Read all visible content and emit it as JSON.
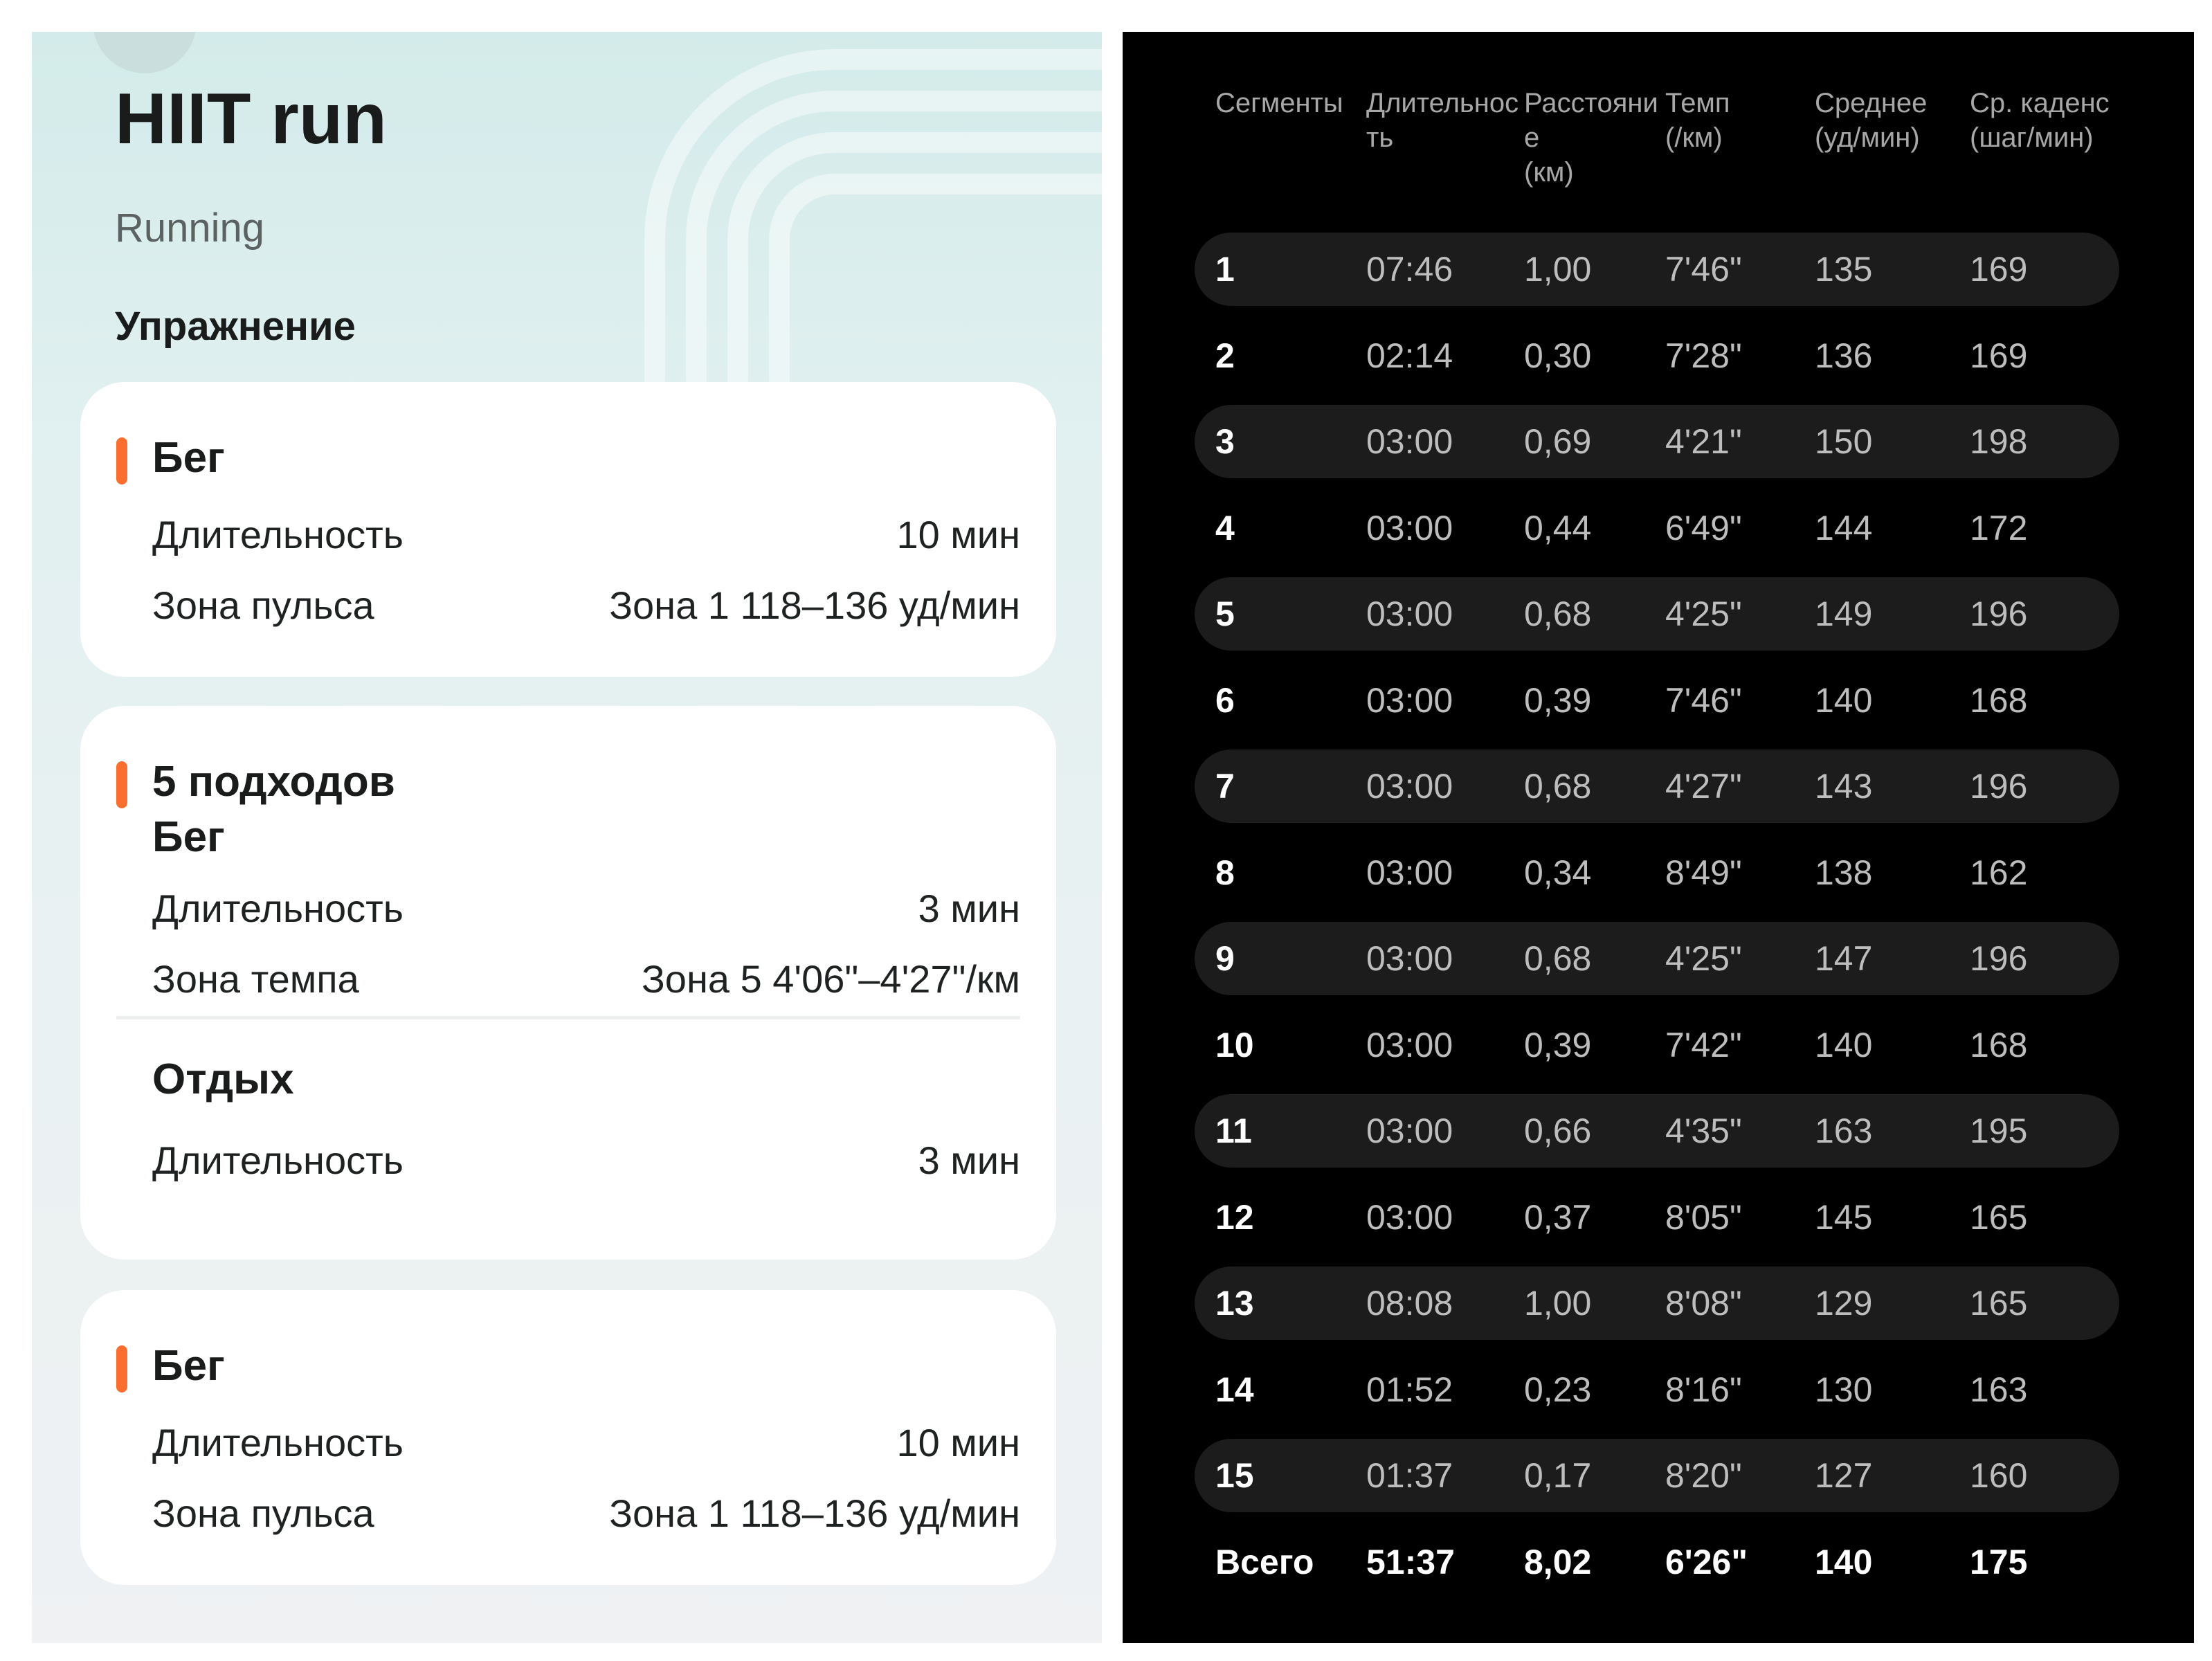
{
  "workout": {
    "title": "HIIT run",
    "subtitle": "Running",
    "section_title": "Упражнение",
    "card1": {
      "step": {
        "title": "Бег"
      },
      "duration": {
        "label": "Длительность",
        "value": "10 мин"
      },
      "zone": {
        "label": "Зона пульса",
        "value": "Зона 1 118–136 уд/мин"
      }
    },
    "card2": {
      "sets_title": "5 подходов",
      "run": {
        "title": "Бег",
        "duration": {
          "label": "Длительность",
          "value": "3 мин"
        },
        "zone": {
          "label": "Зона темпа",
          "value": "Зона 5 4'06\"–4'27\"/км"
        }
      },
      "rest": {
        "title": "Отдых",
        "duration": {
          "label": "Длительность",
          "value": "3 мин"
        }
      }
    },
    "card3": {
      "step": {
        "title": "Бег"
      },
      "duration": {
        "label": "Длительность",
        "value": "10 мин"
      },
      "zone": {
        "label": "Зона пульса",
        "value": "Зона 1 118–136 уд/мин"
      }
    },
    "colors": {
      "accent": "#fb6f2e"
    }
  },
  "segments_table": {
    "headers": [
      "Сегменты",
      "Длительнос\nть",
      "Расстояни\nе\n(км)",
      "Темп\n(/км)",
      "Среднее\n(уд/мин)",
      "Ср. каденс\n(шаг/мин)"
    ],
    "rows": [
      [
        "1",
        "07:46",
        "1,00",
        "7'46\"",
        "135",
        "169"
      ],
      [
        "2",
        "02:14",
        "0,30",
        "7'28\"",
        "136",
        "169"
      ],
      [
        "3",
        "03:00",
        "0,69",
        "4'21\"",
        "150",
        "198"
      ],
      [
        "4",
        "03:00",
        "0,44",
        "6'49\"",
        "144",
        "172"
      ],
      [
        "5",
        "03:00",
        "0,68",
        "4'25\"",
        "149",
        "196"
      ],
      [
        "6",
        "03:00",
        "0,39",
        "7'46\"",
        "140",
        "168"
      ],
      [
        "7",
        "03:00",
        "0,68",
        "4'27\"",
        "143",
        "196"
      ],
      [
        "8",
        "03:00",
        "0,34",
        "8'49\"",
        "138",
        "162"
      ],
      [
        "9",
        "03:00",
        "0,68",
        "4'25\"",
        "147",
        "196"
      ],
      [
        "10",
        "03:00",
        "0,39",
        "7'42\"",
        "140",
        "168"
      ],
      [
        "11",
        "03:00",
        "0,66",
        "4'35\"",
        "163",
        "195"
      ],
      [
        "12",
        "03:00",
        "0,37",
        "8'05\"",
        "145",
        "165"
      ],
      [
        "13",
        "08:08",
        "1,00",
        "8'08\"",
        "129",
        "165"
      ],
      [
        "14",
        "01:52",
        "0,23",
        "8'16\"",
        "130",
        "163"
      ],
      [
        "15",
        "01:37",
        "0,17",
        "8'20\"",
        "127",
        "160"
      ]
    ],
    "total": [
      "Всего",
      "51:37",
      "8,02",
      "6'26\"",
      "140",
      "175"
    ]
  }
}
